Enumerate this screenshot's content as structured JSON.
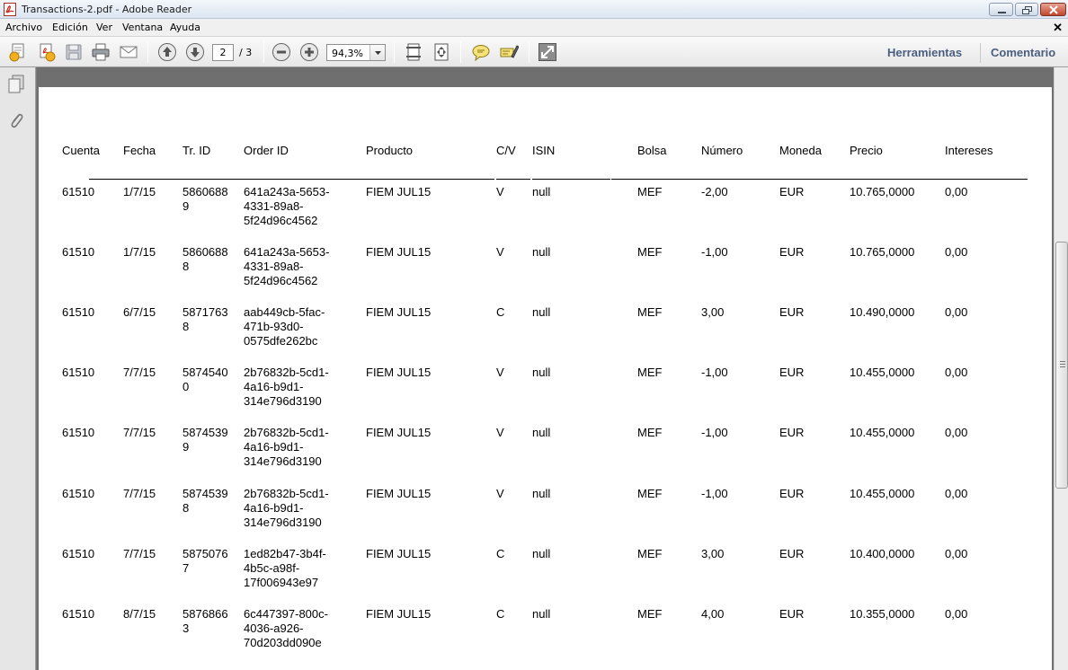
{
  "window": {
    "title": "Transactions-2.pdf - Adobe Reader"
  },
  "menubar": {
    "items": [
      "Archivo",
      "Edición",
      "Ver",
      "Ventana",
      "Ayuda"
    ]
  },
  "toolbar": {
    "page_current": "2",
    "page_total": "/ 3",
    "zoom": "94,3%",
    "tools_label": "Herramientas",
    "comment_label": "Comentario"
  },
  "table": {
    "headers": [
      "Cuenta",
      "Fecha",
      "Tr. ID",
      "Order ID",
      "Producto",
      "C/V",
      "ISIN",
      "Bolsa",
      "Número",
      "Moneda",
      "Precio",
      "Intereses"
    ],
    "rows": [
      {
        "cuenta": "61510",
        "fecha": "1/7/15",
        "trid": [
          "5860688",
          "9"
        ],
        "orderid": [
          "641a243a-5653-",
          "4331-89a8-",
          "5f24d96c4562"
        ],
        "producto": "FIEM JUL15",
        "cv": "V",
        "isin": "null",
        "bolsa": "MEF",
        "numero": "-2,00",
        "moneda": "EUR",
        "precio": "10.765,0000",
        "intereses": "0,00"
      },
      {
        "cuenta": "61510",
        "fecha": "1/7/15",
        "trid": [
          "5860688",
          "8"
        ],
        "orderid": [
          "641a243a-5653-",
          "4331-89a8-",
          "5f24d96c4562"
        ],
        "producto": "FIEM JUL15",
        "cv": "V",
        "isin": "null",
        "bolsa": "MEF",
        "numero": "-1,00",
        "moneda": "EUR",
        "precio": "10.765,0000",
        "intereses": "0,00"
      },
      {
        "cuenta": "61510",
        "fecha": "6/7/15",
        "trid": [
          "5871763",
          "8"
        ],
        "orderid": [
          "aab449cb-5fac-",
          "471b-93d0-",
          "0575dfe262bc"
        ],
        "producto": "FIEM JUL15",
        "cv": "C",
        "isin": "null",
        "bolsa": "MEF",
        "numero": "3,00",
        "moneda": "EUR",
        "precio": "10.490,0000",
        "intereses": "0,00"
      },
      {
        "cuenta": "61510",
        "fecha": "7/7/15",
        "trid": [
          "5874540",
          "0"
        ],
        "orderid": [
          "2b76832b-5cd1-",
          "4a16-b9d1-",
          "314e796d3190"
        ],
        "producto": "FIEM JUL15",
        "cv": "V",
        "isin": "null",
        "bolsa": "MEF",
        "numero": "-1,00",
        "moneda": "EUR",
        "precio": "10.455,0000",
        "intereses": "0,00"
      },
      {
        "cuenta": "61510",
        "fecha": "7/7/15",
        "trid": [
          "5874539",
          "9"
        ],
        "orderid": [
          "2b76832b-5cd1-",
          "4a16-b9d1-",
          "314e796d3190"
        ],
        "producto": "FIEM JUL15",
        "cv": "V",
        "isin": "null",
        "bolsa": "MEF",
        "numero": "-1,00",
        "moneda": "EUR",
        "precio": "10.455,0000",
        "intereses": "0,00"
      },
      {
        "cuenta": "61510",
        "fecha": "7/7/15",
        "trid": [
          "5874539",
          "8"
        ],
        "orderid": [
          "2b76832b-5cd1-",
          "4a16-b9d1-",
          "314e796d3190"
        ],
        "producto": "FIEM JUL15",
        "cv": "V",
        "isin": "null",
        "bolsa": "MEF",
        "numero": "-1,00",
        "moneda": "EUR",
        "precio": "10.455,0000",
        "intereses": "0,00"
      },
      {
        "cuenta": "61510",
        "fecha": "7/7/15",
        "trid": [
          "5875076",
          "7"
        ],
        "orderid": [
          "1ed82b47-3b4f-",
          "4b5c-a98f-",
          "17f006943e97"
        ],
        "producto": "FIEM JUL15",
        "cv": "C",
        "isin": "null",
        "bolsa": "MEF",
        "numero": "3,00",
        "moneda": "EUR",
        "precio": "10.400,0000",
        "intereses": "0,00"
      },
      {
        "cuenta": "61510",
        "fecha": "8/7/15",
        "trid": [
          "5876866",
          "3"
        ],
        "orderid": [
          "6c447397-800c-",
          "4036-a926-",
          "70d203dd090e"
        ],
        "producto": "FIEM JUL15",
        "cv": "C",
        "isin": "null",
        "bolsa": "MEF",
        "numero": "4,00",
        "moneda": "EUR",
        "precio": "10.355,0000",
        "intereses": "0,00"
      }
    ]
  }
}
